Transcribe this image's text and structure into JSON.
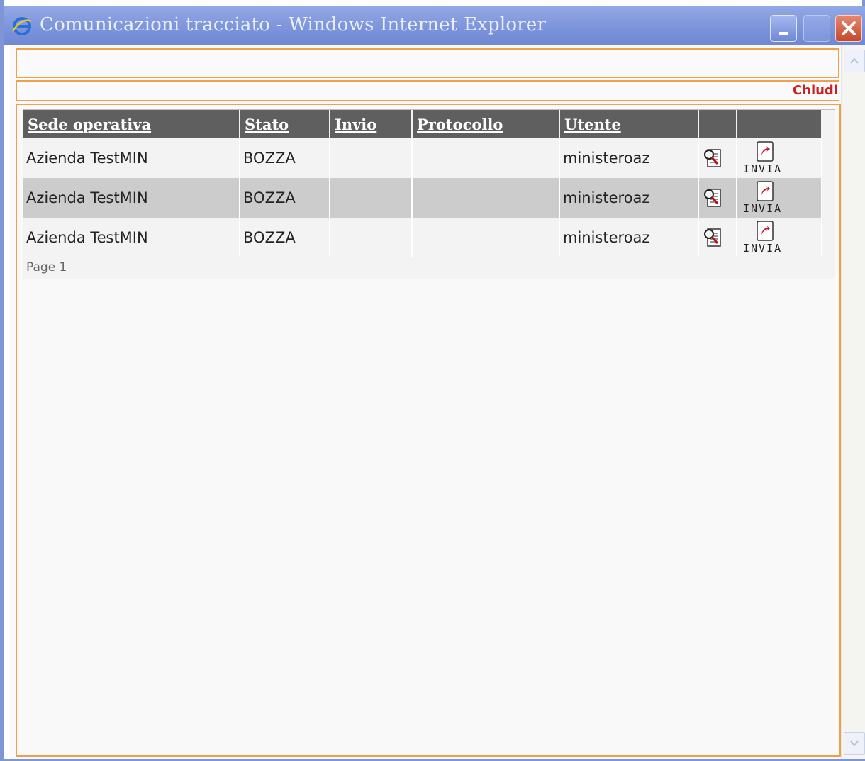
{
  "window": {
    "title": "Comunicazioni tracciato - Windows Internet Explorer",
    "icon": "ie-icon",
    "controls": [
      "minimize",
      "maximize",
      "close"
    ]
  },
  "toolbar": {
    "close_link": "Chiudi"
  },
  "grid": {
    "columns": [
      "Sede operativa",
      "Stato",
      "Invio",
      "Protocollo",
      "Utente",
      "",
      ""
    ],
    "rows": [
      {
        "sede": "Azienda TestMIN",
        "stato": "BOZZA",
        "invio": "",
        "protocollo": "",
        "utente": "ministeroaz",
        "action": "INVIA"
      },
      {
        "sede": "Azienda TestMIN",
        "stato": "BOZZA",
        "invio": "",
        "protocollo": "",
        "utente": "ministeroaz",
        "action": "INVIA"
      },
      {
        "sede": "Azienda TestMIN",
        "stato": "BOZZA",
        "invio": "",
        "protocollo": "",
        "utente": "ministeroaz",
        "action": "INVIA"
      }
    ],
    "pager": "Page 1"
  },
  "colors": {
    "frame": "#f0a04b",
    "header_bg": "#5f5f5f",
    "link_red": "#cc1f1f",
    "titlebar": "#7f96d6"
  }
}
